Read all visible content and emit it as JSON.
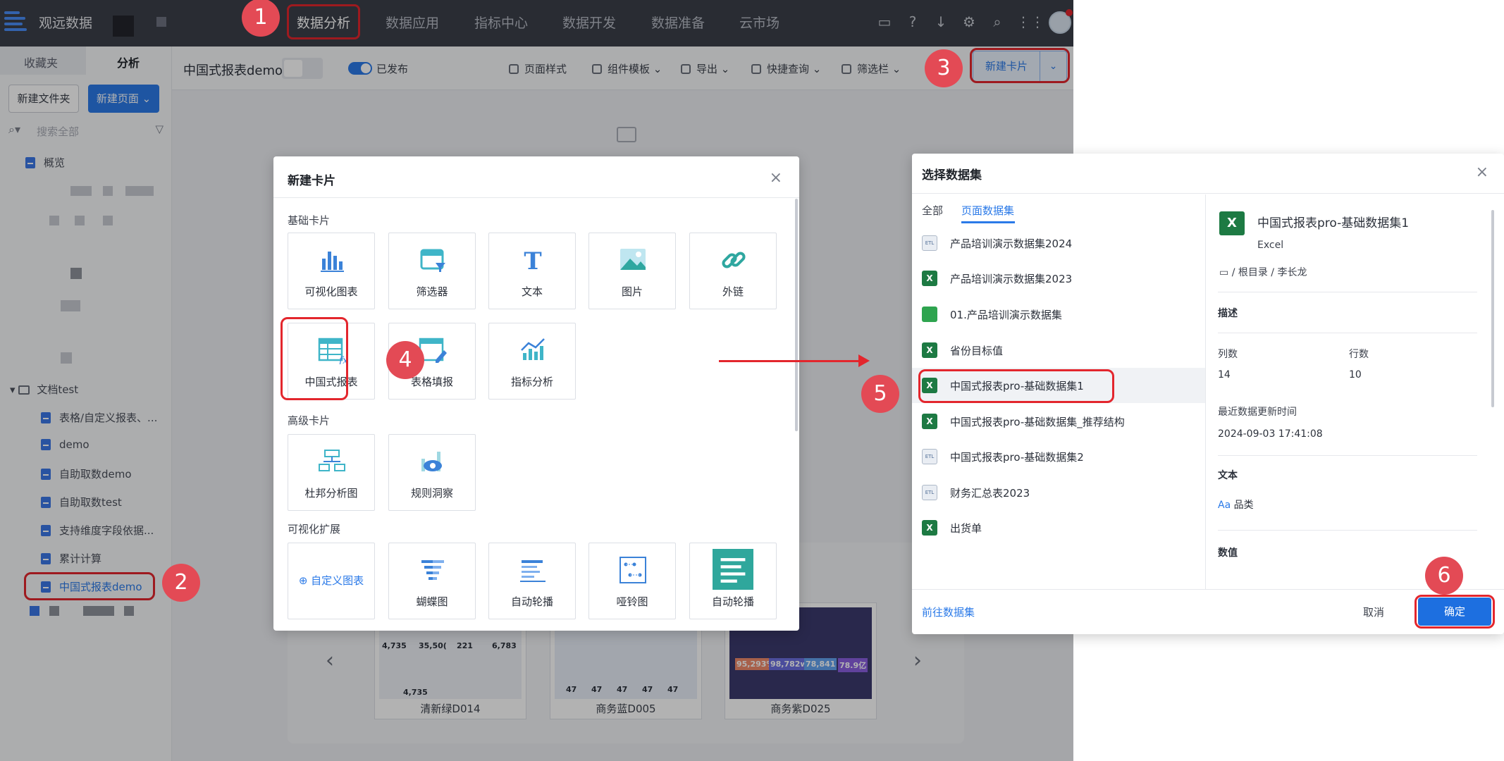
{
  "topbar": {
    "brand": "观远数据",
    "nav": [
      "数据分析",
      "数据应用",
      "指标中心",
      "数据开发",
      "数据准备",
      "云市场"
    ]
  },
  "sidebar": {
    "tabs": [
      "收藏夹",
      "分析"
    ],
    "new_folder": "新建文件夹",
    "new_page": "新建页面",
    "search_placeholder": "搜索全部",
    "overview": "概览",
    "folder": "文档test",
    "items": [
      "表格/自定义报表、...",
      "demo",
      "自助取数demo",
      "自助取数test",
      "支持维度字段依据...",
      "累计计算",
      "中国式报表demo"
    ]
  },
  "toolbar": {
    "page_name": "中国式报表demo",
    "published": "已发布",
    "tools": [
      "页面样式",
      "组件模板",
      "导出",
      "快捷查询",
      "筛选栏"
    ],
    "new_card": "新建卡片"
  },
  "templates": [
    {
      "name": "清新绿D014",
      "nums": [
        "4,735",
        "35,50(",
        "221",
        "6,783",
        "4,735"
      ]
    },
    {
      "name": "商务蓝D005",
      "nums": [
        "47",
        "47",
        "47",
        "47",
        "47"
      ]
    },
    {
      "name": "商务紫D025",
      "nums": [
        "95,293%",
        "98,782w",
        "78,841",
        "78.9亿"
      ]
    }
  ],
  "modal_new_card": {
    "title": "新建卡片",
    "basic_section": "基础卡片",
    "basic": [
      "可视化图表",
      "筛选器",
      "文本",
      "图片",
      "外链",
      "中国式报表",
      "表格填报",
      "指标分析"
    ],
    "advanced_section": "高级卡片",
    "advanced": [
      "杜邦分析图",
      "规则洞察"
    ],
    "ext_section": "可视化扩展",
    "custom_chart": "自定义图表",
    "ext": [
      "蝴蝶图",
      "自动轮播",
      "哑铃图",
      "自动轮播"
    ]
  },
  "modal_dataset": {
    "title": "选择数据集",
    "tabs": [
      "全部",
      "页面数据集"
    ],
    "list": [
      {
        "name": "产品培训演示数据集2024",
        "type": "etl"
      },
      {
        "name": "产品培训演示数据集2023",
        "type": "excel"
      },
      {
        "name": "01.产品培训演示数据集",
        "type": "sheet"
      },
      {
        "name": "省份目标值",
        "type": "excel"
      },
      {
        "name": "中国式报表pro-基础数据集1",
        "type": "excel"
      },
      {
        "name": "中国式报表pro-基础数据集_推荐结构",
        "type": "excel"
      },
      {
        "name": "中国式报表pro-基础数据集2",
        "type": "etl"
      },
      {
        "name": "财务汇总表2023",
        "type": "etl"
      },
      {
        "name": "出货单",
        "type": "excel"
      }
    ],
    "detail": {
      "name": "中国式报表pro-基础数据集1",
      "kind": "Excel",
      "path": "/ 根目录 / 李长龙",
      "desc_label": "描述",
      "cols_label": "列数",
      "cols": "14",
      "rows_label": "行数",
      "rows": "10",
      "updated_label": "最近数据更新时间",
      "updated": "2024-09-03 17:41:08",
      "text_label": "文本",
      "text_field": "品类",
      "num_label": "数值"
    },
    "goto": "前往数据集",
    "cancel": "取消",
    "ok": "确定"
  },
  "steps": [
    "1",
    "2",
    "3",
    "4",
    "5",
    "6"
  ]
}
